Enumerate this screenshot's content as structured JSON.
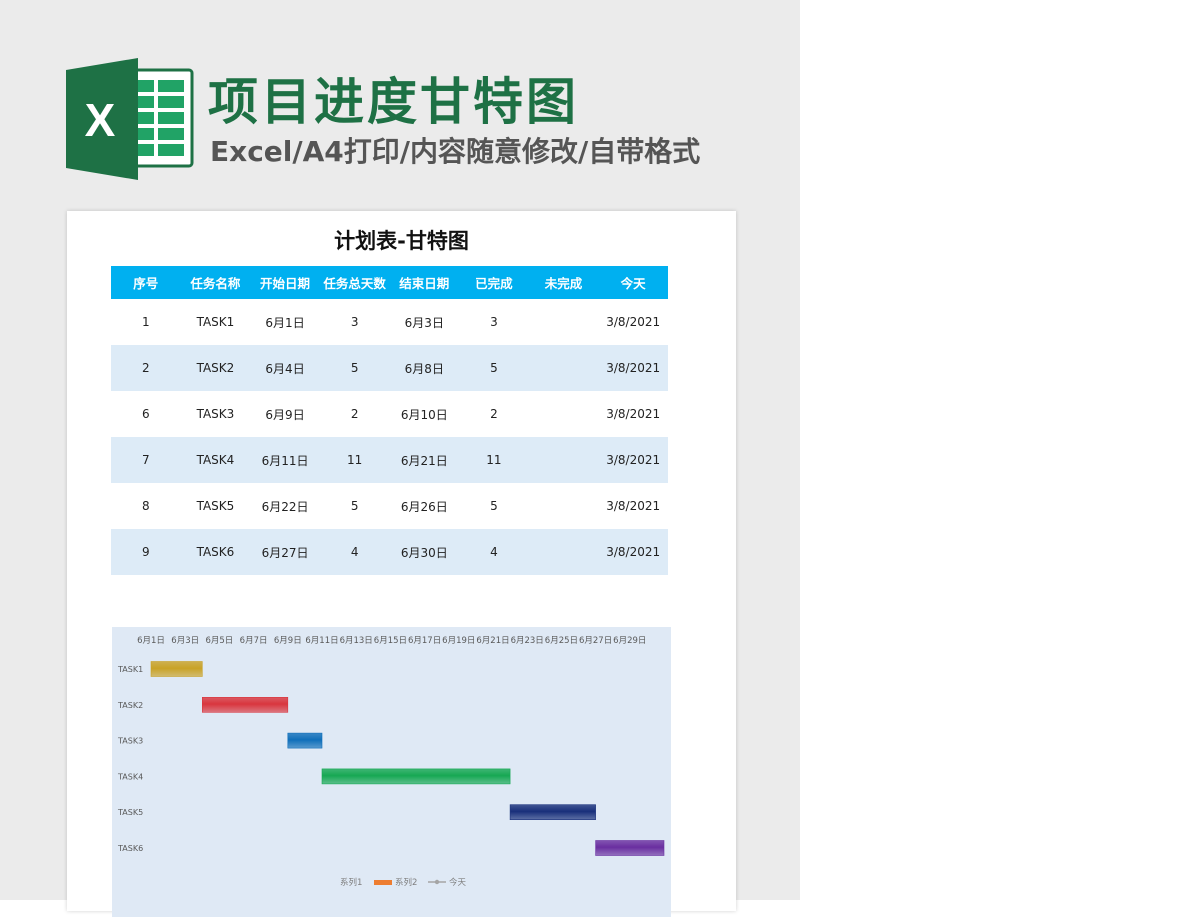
{
  "header": {
    "title": "项目进度甘特图",
    "subtitle": "Excel/A4打印/内容随意修改/自带格式",
    "logo_letter": "X"
  },
  "sheet": {
    "title": "计划表-甘特图",
    "columns": [
      "序号",
      "任务名称",
      "开始日期",
      "任务总天数",
      "结束日期",
      "已完成",
      "未完成",
      "今天"
    ],
    "rows": [
      [
        "1",
        "TASK1",
        "6月1日",
        "3",
        "6月3日",
        "3",
        "",
        "3/8/2021"
      ],
      [
        "2",
        "TASK2",
        "6月4日",
        "5",
        "6月8日",
        "5",
        "",
        "3/8/2021"
      ],
      [
        "6",
        "TASK3",
        "6月9日",
        "2",
        "6月10日",
        "2",
        "",
        "3/8/2021"
      ],
      [
        "7",
        "TASK4",
        "6月11日",
        "11",
        "6月21日",
        "11",
        "",
        "3/8/2021"
      ],
      [
        "8",
        "TASK5",
        "6月22日",
        "5",
        "6月26日",
        "5",
        "",
        "3/8/2021"
      ],
      [
        "9",
        "TASK6",
        "6月27日",
        "4",
        "6月30日",
        "4",
        "",
        "3/8/2021"
      ]
    ]
  },
  "chart_data": {
    "type": "bar",
    "orientation": "horizontal",
    "stacked": true,
    "x_ticks": [
      "6月1日",
      "6月3日",
      "6月5日",
      "6月7日",
      "6月9日",
      "6月11日",
      "6月13日",
      "6月15日",
      "6月17日",
      "6月19日",
      "6月21日",
      "6月23日",
      "6月25日",
      "6月27日",
      "6月29日"
    ],
    "x_tick_position": "top",
    "categories": [
      "TASK1",
      "TASK2",
      "TASK3",
      "TASK4",
      "TASK5",
      "TASK6"
    ],
    "tasks": [
      {
        "name": "TASK1",
        "start": "6月1日",
        "days": 3,
        "color": "#c9a227"
      },
      {
        "name": "TASK2",
        "start": "6月4日",
        "days": 5,
        "color": "#d9363e"
      },
      {
        "name": "TASK3",
        "start": "6月9日",
        "days": 2,
        "color": "#0f6fba"
      },
      {
        "name": "TASK4",
        "start": "6月11日",
        "days": 11,
        "color": "#16a853"
      },
      {
        "name": "TASK5",
        "start": "6月22日",
        "days": 5,
        "color": "#182f7a"
      },
      {
        "name": "TASK6",
        "start": "6月27日",
        "days": 4,
        "color": "#6a2fa0"
      }
    ],
    "legend": [
      {
        "name": "系列1",
        "marker": "none"
      },
      {
        "name": "系列2",
        "marker": "bar",
        "color": "#ed7d31"
      },
      {
        "name": "今天",
        "marker": "line",
        "color": "#a5a5a5"
      }
    ],
    "legend_position": "bottom",
    "grid": false,
    "background": "#dfe9f5"
  },
  "colors": {
    "brand_green": "#1e7145",
    "header_blue": "#00b0f0",
    "band_blue": "#ddebf7"
  }
}
